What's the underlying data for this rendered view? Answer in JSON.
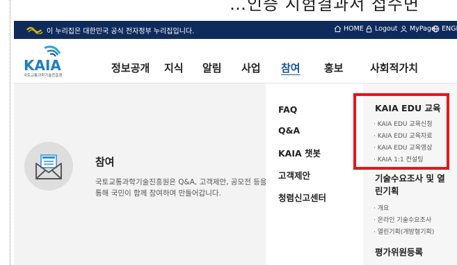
{
  "caption": {
    "text": "…인증 시험결과서 접수면"
  },
  "gov_bar": {
    "notice": "이 누리집은 대한민국 공식 전자정부 누리집입니다.",
    "utils": [
      {
        "label": "HOME",
        "icon": "home-icon"
      },
      {
        "label": "Logout",
        "icon": "lock-icon"
      },
      {
        "label": "MyPage",
        "icon": "user-icon"
      },
      {
        "label": "ENGLISH",
        "icon": "globe-icon"
      }
    ]
  },
  "header": {
    "logo_text": "KAIA",
    "logo_subtitle": "국토교통과학기술진흥원",
    "nav": [
      "정보공개",
      "지식",
      "알림",
      "사업",
      "참여",
      "홍보",
      "사회적가치"
    ],
    "active_nav": "참여"
  },
  "hero": {
    "title": "참여",
    "description": "국토교통과학기술진흥원은 Q&A, 고객제안, 공모전 등을 통해 국민이 함께 참여하며 만들어갑니다."
  },
  "menu_col1": [
    "FAQ",
    "Q&A",
    "KAIA 챗봇",
    "고객제안",
    "청렴신고센터"
  ],
  "menu_col2": {
    "groups": [
      {
        "title": "KAIA EDU 교육",
        "links": [
          "· KAIA EDU 교육신청",
          "· KAIA EDU 교육자료",
          "· KAIA EDU 교육영상",
          "· KAIA 1:1 컨설팅"
        ]
      },
      {
        "title": "기술수요조사 및 열린기획",
        "links": [
          "· 개요",
          "· 온라인 기술수요조사",
          "· 열린기획(개방형기획)"
        ]
      },
      {
        "title": "평가위원등록",
        "links": []
      }
    ]
  },
  "colors": {
    "gov_bar": "#0f2b5c",
    "accent": "#1a4fa8",
    "highlight": "#e8141b",
    "logo_gold": "#d8b300"
  }
}
